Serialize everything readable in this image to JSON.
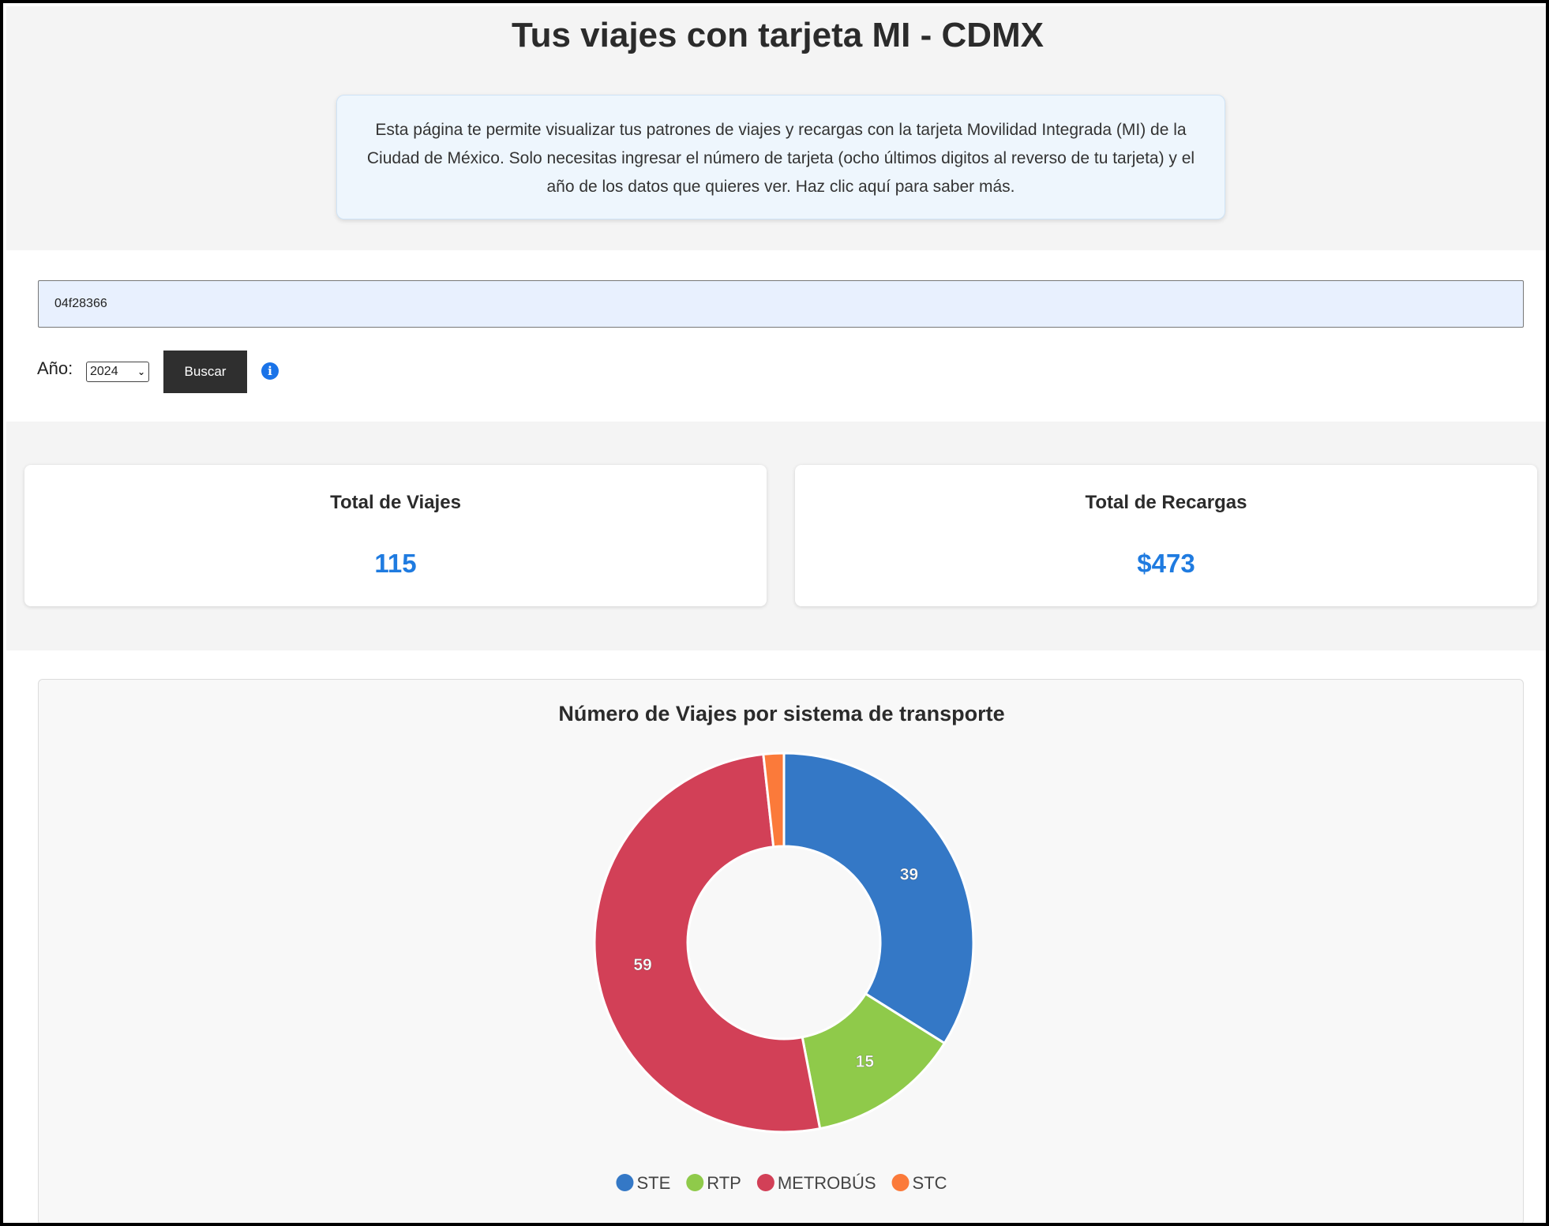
{
  "page": {
    "title": "Tus viajes con tarjeta MI - CDMX",
    "description": "Esta página te permite visualizar tus patrones de viajes y recargas con la tarjeta Movilidad Integrada (MI) de la Ciudad de México. Solo necesitas ingresar el número de tarjeta (ocho últimos digitos al reverso de tu tarjeta) y el año de los datos que quieres ver. Haz clic aquí para saber más."
  },
  "search": {
    "card_value": "04f28366",
    "year_label": "Año:",
    "year_selected": "2024",
    "button_label": "Buscar",
    "info_icon": "info-circle-icon"
  },
  "stats": {
    "trips_title": "Total de Viajes",
    "trips_value": "115",
    "recharges_title": "Total de Recargas",
    "recharges_value": "$473"
  },
  "colors": {
    "accent": "#1f7be0",
    "button": "#2f2f2f"
  },
  "chart_data": {
    "type": "pie",
    "title": "Número de Viajes por sistema de transporte",
    "categories": [
      "STE",
      "RTP",
      "METROBÚS",
      "STC"
    ],
    "values": [
      39,
      15,
      59,
      2
    ],
    "colors": [
      "#3478c6",
      "#8fca4a",
      "#d24057",
      "#fb7a3a"
    ],
    "data_labels": [
      "39",
      "15",
      "59",
      ""
    ],
    "legend_position": "bottom"
  }
}
